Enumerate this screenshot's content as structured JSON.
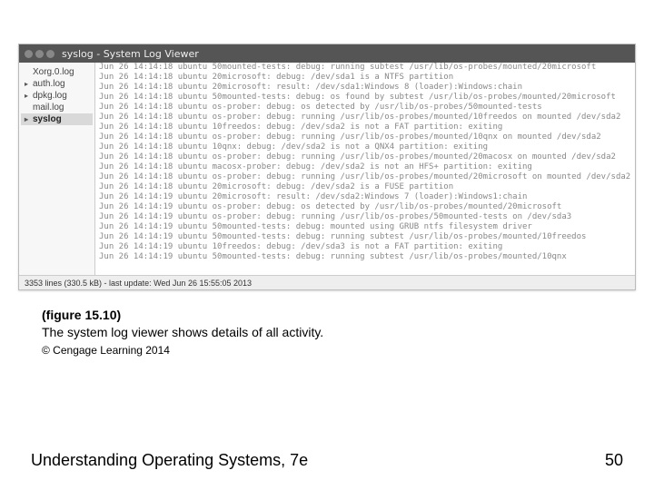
{
  "window": {
    "title": "syslog - System Log Viewer",
    "sidebar": {
      "items": [
        {
          "label": "Xorg.0.log",
          "selected": false,
          "expandable": false
        },
        {
          "label": "auth.log",
          "selected": false,
          "expandable": true
        },
        {
          "label": "dpkg.log",
          "selected": false,
          "expandable": true
        },
        {
          "label": "mail.log",
          "selected": false,
          "expandable": false
        },
        {
          "label": "syslog",
          "selected": true,
          "expandable": true
        }
      ]
    },
    "status": "3353 lines (330.5 kB) - last update: Wed Jun 26 15:55:05 2013",
    "log": [
      "Jun 26 14:14:18 ubuntu 50mounted-tests: debug: running subtest /usr/lib/os-probes/mounted/20microsoft",
      "Jun 26 14:14:18 ubuntu 20microsoft: debug: /dev/sda1 is a NTFS partition",
      "Jun 26 14:14:18 ubuntu 20microsoft: result: /dev/sda1:Windows 8 (loader):Windows:chain",
      "Jun 26 14:14:18 ubuntu 50mounted-tests: debug: os found by subtest /usr/lib/os-probes/mounted/20microsoft",
      "Jun 26 14:14:18 ubuntu os-prober: debug: os detected by /usr/lib/os-probes/50mounted-tests",
      "Jun 26 14:14:18 ubuntu os-prober: debug: running /usr/lib/os-probes/mounted/10freedos on mounted /dev/sda2",
      "Jun 26 14:14:18 ubuntu 10freedos: debug: /dev/sda2 is not a FAT partition: exiting",
      "Jun 26 14:14:18 ubuntu os-prober: debug: running /usr/lib/os-probes/mounted/10qnx on mounted /dev/sda2",
      "Jun 26 14:14:18 ubuntu 10qnx: debug: /dev/sda2 is not a QNX4 partition: exiting",
      "Jun 26 14:14:18 ubuntu os-prober: debug: running /usr/lib/os-probes/mounted/20macosx on mounted /dev/sda2",
      "Jun 26 14:14:18 ubuntu macosx-prober: debug: /dev/sda2 is not an HFS+ partition: exiting",
      "Jun 26 14:14:18 ubuntu os-prober: debug: running /usr/lib/os-probes/mounted/20microsoft on mounted /dev/sda2",
      "Jun 26 14:14:18 ubuntu 20microsoft: debug: /dev/sda2 is a FUSE partition",
      "Jun 26 14:14:19 ubuntu 20microsoft: result: /dev/sda2:Windows 7 (loader):Windows1:chain",
      "Jun 26 14:14:19 ubuntu os-prober: debug: os detected by /usr/lib/os-probes/mounted/20microsoft",
      "Jun 26 14:14:19 ubuntu os-prober: debug: running /usr/lib/os-probes/50mounted-tests on /dev/sda3",
      "Jun 26 14:14:19 ubuntu 50mounted-tests: debug: mounted using GRUB ntfs filesystem driver",
      "Jun 26 14:14:19 ubuntu 50mounted-tests: debug: running subtest /usr/lib/os-probes/mounted/10freedos",
      "Jun 26 14:14:19 ubuntu 10freedos: debug: /dev/sda3 is not a FAT partition: exiting",
      "Jun 26 14:14:19 ubuntu 50mounted-tests: debug: running subtest /usr/lib/os-probes/mounted/10qnx"
    ]
  },
  "caption": {
    "figref": "(figure 15.10)",
    "text": "The system log viewer shows details of all activity.",
    "copyright": "© Cengage Learning 2014"
  },
  "footer": {
    "book": "Understanding Operating Systems, 7e",
    "page": "50"
  }
}
